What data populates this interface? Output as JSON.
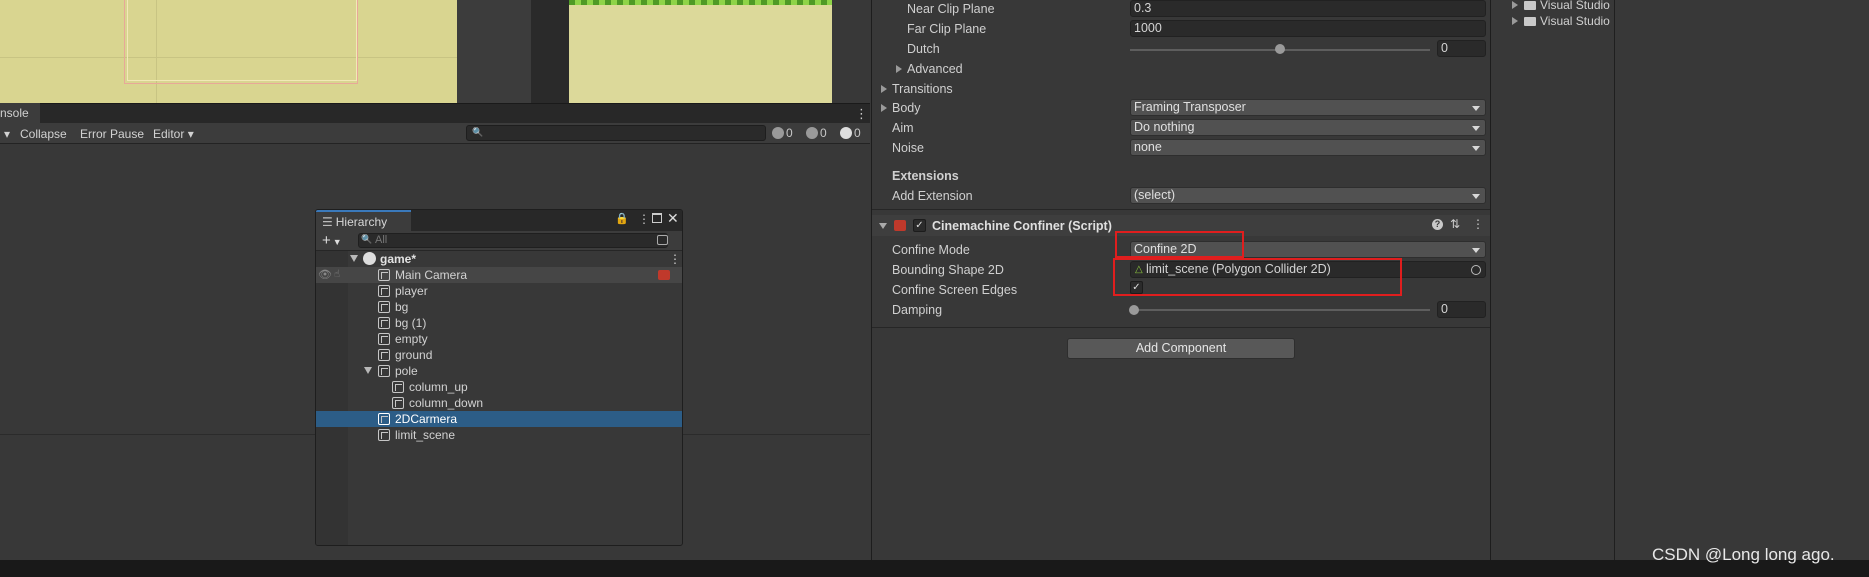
{
  "console": {
    "tab": "nsole",
    "toolbar": {
      "collapse": "Collapse",
      "error_pause": "Error Pause",
      "editor": "Editor"
    },
    "counts": {
      "info": "0",
      "warn": "0",
      "error": "0"
    }
  },
  "hierarchy": {
    "tab": "Hierarchy",
    "search_placeholder": "All",
    "scene": "game*",
    "items": [
      {
        "name": "Main Camera"
      },
      {
        "name": "player"
      },
      {
        "name": "bg"
      },
      {
        "name": "bg (1)"
      },
      {
        "name": "empty"
      },
      {
        "name": "ground"
      },
      {
        "name": "pole"
      },
      {
        "name": "column_up"
      },
      {
        "name": "column_down"
      },
      {
        "name": "2DCarmera"
      },
      {
        "name": "limit_scene"
      }
    ]
  },
  "inspector": {
    "near_clip_label": "Near Clip Plane",
    "near_clip_value": "0.3",
    "far_clip_label": "Far Clip Plane",
    "far_clip_value": "1000",
    "dutch_label": "Dutch",
    "dutch_value": "0",
    "advanced_label": "Advanced",
    "transitions_label": "Transitions",
    "body_label": "Body",
    "body_value": "Framing Transposer",
    "aim_label": "Aim",
    "aim_value": "Do nothing",
    "noise_label": "Noise",
    "noise_value": "none",
    "extensions_label": "Extensions",
    "add_extension_label": "Add Extension",
    "add_extension_value": "(select)",
    "confiner_title": "Cinemachine Confiner (Script)",
    "confine_mode_label": "Confine Mode",
    "confine_mode_value": "Confine 2D",
    "bounding_label": "Bounding Shape 2D",
    "bounding_value": "limit_scene (Polygon Collider 2D)",
    "screen_edges_label": "Confine Screen Edges",
    "damping_label": "Damping",
    "damping_value": "0",
    "add_component": "Add Component"
  },
  "project": {
    "folders": [
      "Visual Studio",
      "Visual Studio"
    ]
  },
  "watermark": "CSDN @Long long ago."
}
